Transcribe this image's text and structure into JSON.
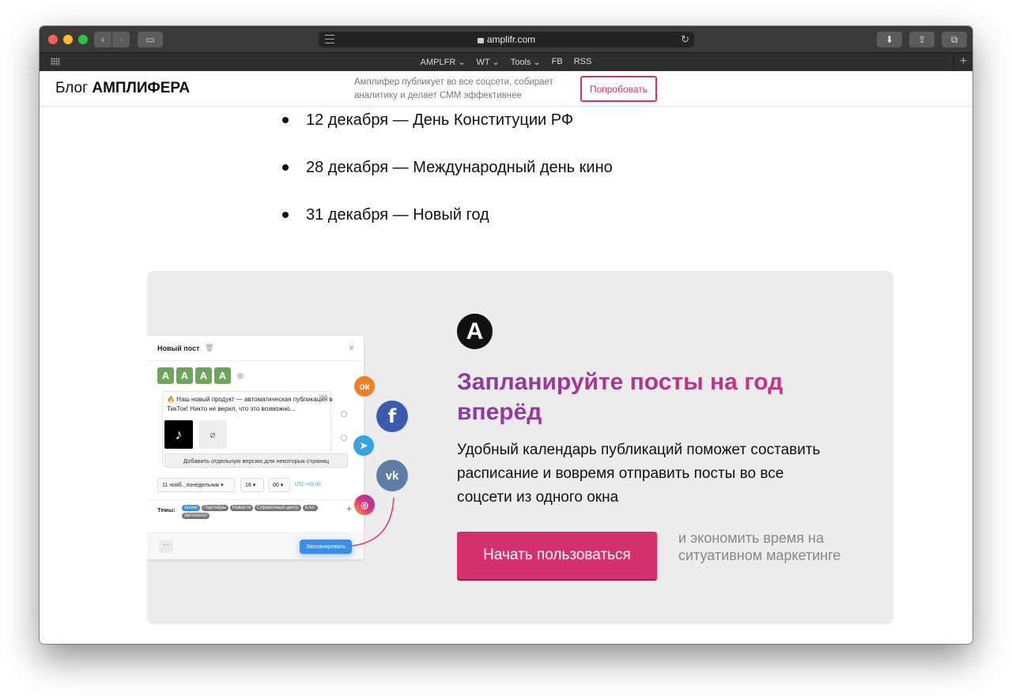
{
  "browser": {
    "url": "amplifr.com",
    "bookmarks": [
      "AMPLFR ⌄",
      "WT ⌄",
      "Tools ⌄",
      "FB",
      "RSS"
    ]
  },
  "header": {
    "logo_light": "Блог ",
    "logo_bold": "АМПЛИФЕРА",
    "tagline": "Амплифер публикует во все соцсети, собирает аналитику и делает СММ эффективнее",
    "try_button": "Попробовать"
  },
  "holidays": [
    "12 декабря — День Конституции РФ",
    "28 декабря — Международный день кино",
    "31 декабря — Новый год"
  ],
  "promo": {
    "logo_letter": "A",
    "title": "Запланируйте посты на год вперёд",
    "text": "Удобный календарь публикаций поможет составить расписание и вовремя отправить посты во все соцсети из одного окна",
    "cta": "Начать пользоваться",
    "note": "и экономить время на ситуативном маркетинге"
  },
  "mock": {
    "title": "Новый пост",
    "post_text": "🔥 Наш новый продукт — автоматическая публикация в ТикТок! Никто не верил, что это возможно...",
    "char_count": "166",
    "add_version": "Добавить отдельную версию для некоторых страниц",
    "date": "11 нояб., понедельник ▾",
    "hour": "16 ▾",
    "minute": "00 ▾",
    "utc": "UTC +03:00",
    "themes_label": "Темы:",
    "tags": [
      "Анонс",
      "Партнёры",
      "Новости",
      "Справочный центр",
      "Блог",
      "Автопилот"
    ],
    "more": "···",
    "schedule": "Запланировать"
  },
  "social_icons": [
    "odnoklassniki-icon",
    "facebook-icon",
    "telegram-icon",
    "vk-icon",
    "instagram-icon"
  ]
}
